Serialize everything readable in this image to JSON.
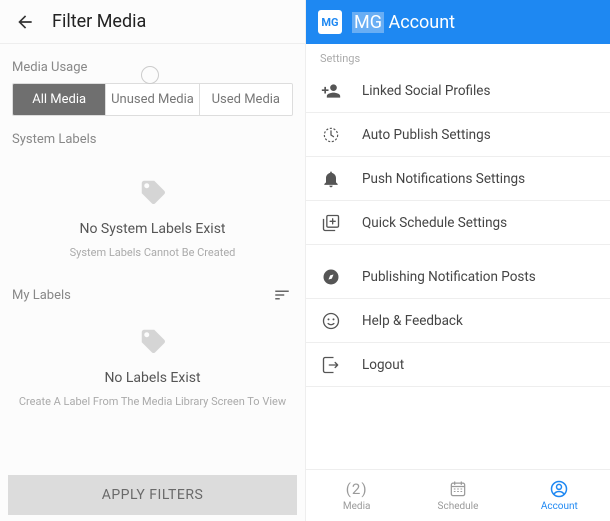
{
  "left": {
    "title": "Filter Media",
    "media_usage_label": "Media Usage",
    "tabs": {
      "all": "All Media",
      "unused": "Unused Media",
      "used": "Used Media"
    },
    "system_labels_heading": "System Labels",
    "system": {
      "empty_title": "No System Labels Exist",
      "empty_sub": "System Labels Cannot Be Created"
    },
    "my_labels_heading": "My Labels",
    "my": {
      "empty_title": "No Labels Exist",
      "empty_sub": "Create A Label From The Media Library Screen To View"
    },
    "apply": "APPLY FILTERS"
  },
  "right": {
    "brand_short": "MG",
    "header_word": "Account",
    "settings_label": "Settings",
    "items": [
      {
        "label": "Linked Social Profiles"
      },
      {
        "label": "Auto Publish Settings"
      },
      {
        "label": "Push Notifications Settings"
      },
      {
        "label": "Quick Schedule Settings"
      },
      {
        "label": "Publishing Notification Posts"
      },
      {
        "label": "Help & Feedback"
      },
      {
        "label": "Logout"
      }
    ],
    "bottom": {
      "media_count": "(2)",
      "media": "Media",
      "schedule": "Schedule",
      "account": "Account"
    }
  }
}
